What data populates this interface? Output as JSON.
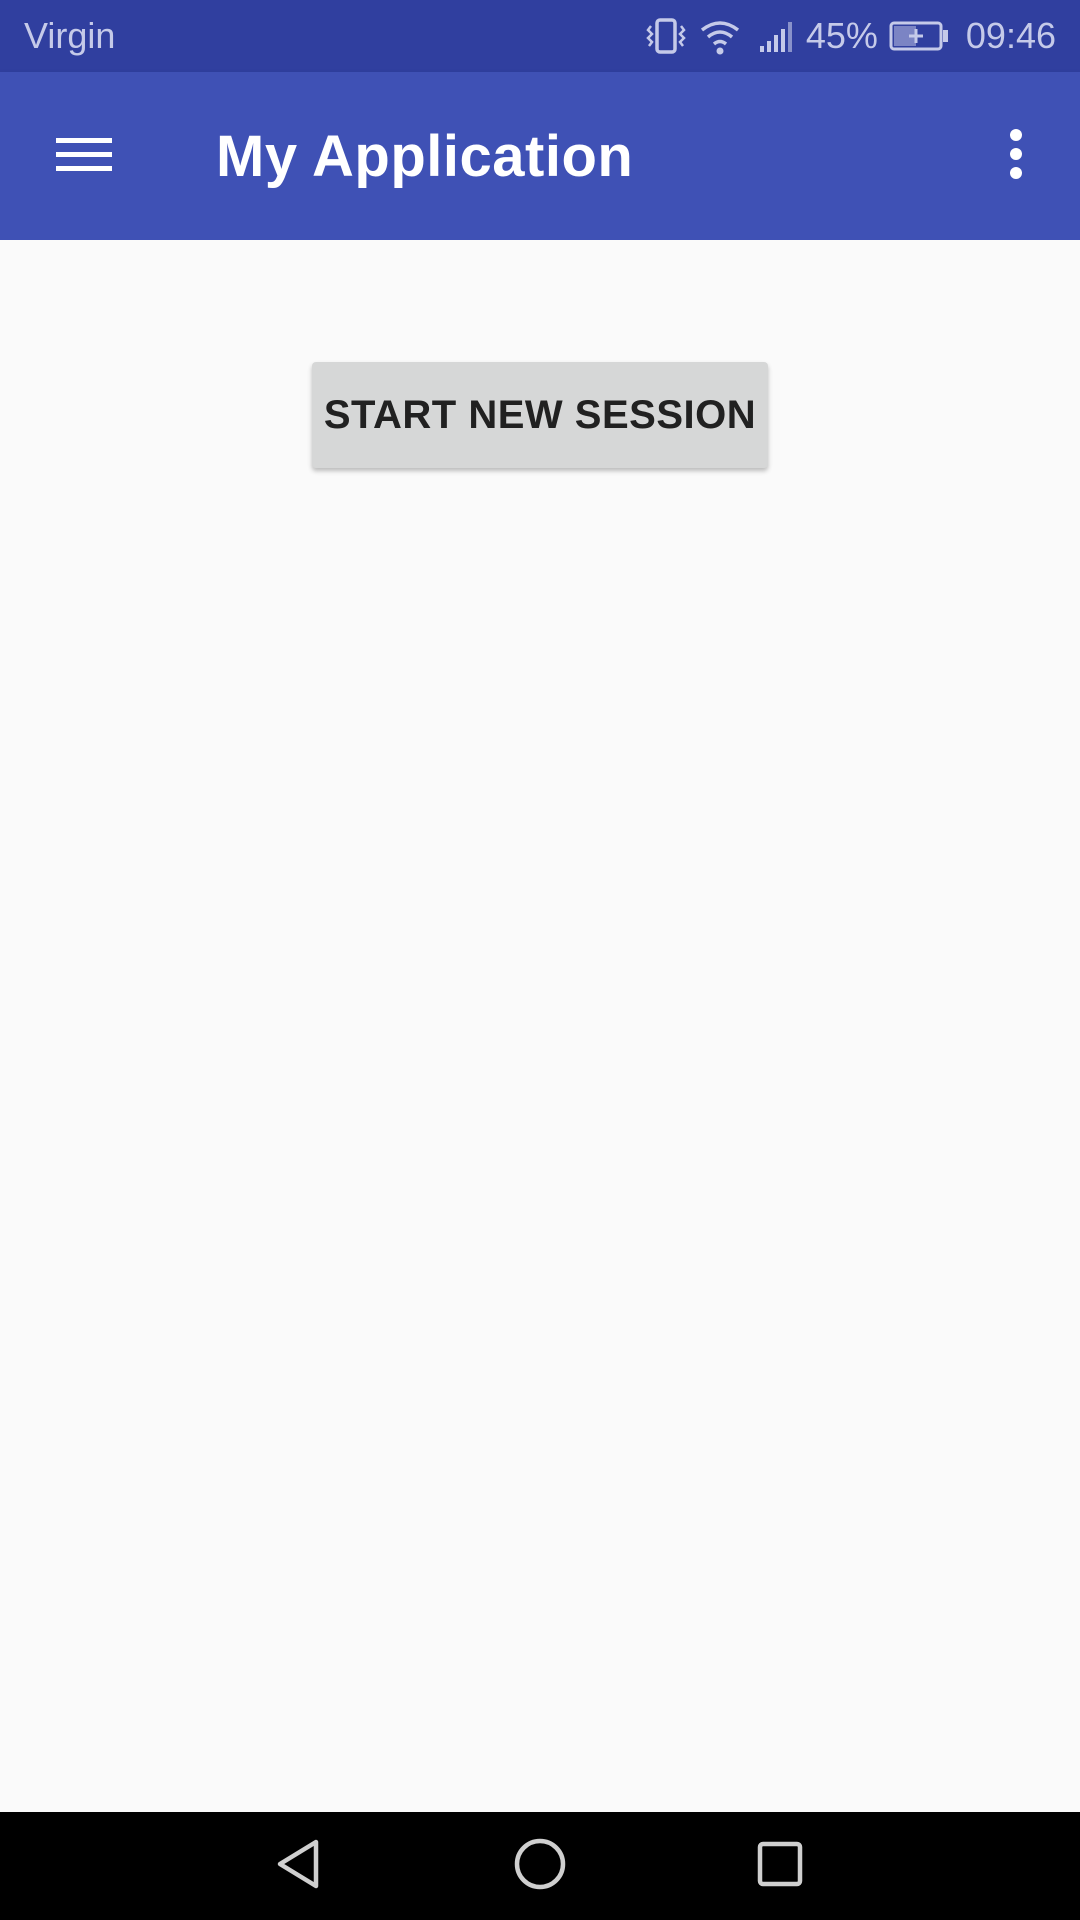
{
  "status_bar": {
    "carrier": "Virgin",
    "battery_percent": "45%",
    "time": "09:46",
    "icons": [
      "vibrate-icon",
      "wifi-icon",
      "signal-icon",
      "battery-charging-icon"
    ],
    "background_color": "#303f9f",
    "text_color": "#c5cae9"
  },
  "app_bar": {
    "title": "My Application",
    "navigation_icon": "menu-icon",
    "action_icon": "more-vert-icon",
    "background_color": "#3f51b5"
  },
  "main": {
    "start_button_label": "START NEW SESSION",
    "button_color": "#d6d7d7"
  },
  "nav_bar": {
    "buttons": [
      "back-icon",
      "home-icon",
      "recents-icon"
    ]
  }
}
